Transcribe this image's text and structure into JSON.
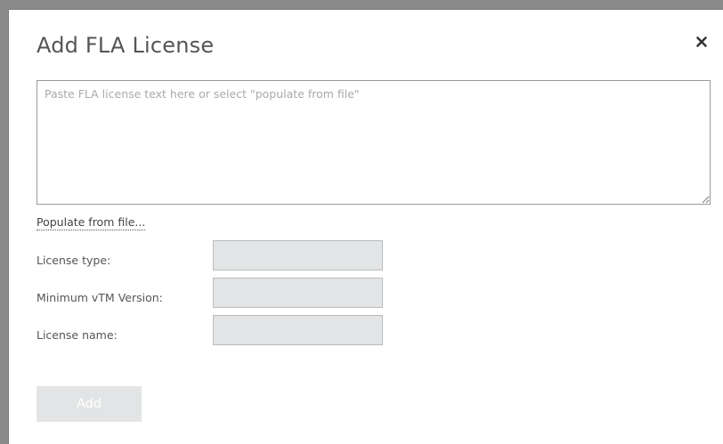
{
  "dialog": {
    "title": "Add FLA License",
    "close_icon": "close-icon"
  },
  "license_text": {
    "value": "",
    "placeholder": "Paste FLA license text here or select \"populate from file\""
  },
  "populate_link": "Populate from file...",
  "fields": [
    {
      "label": "License type:",
      "value": ""
    },
    {
      "label": "Minimum vTM Version:",
      "value": ""
    },
    {
      "label": "License name:",
      "value": ""
    }
  ],
  "add_button": "Add",
  "colors": {
    "backdrop": "#8a8a8a",
    "field_background": "#e2e4e5",
    "button_disabled": "#e2e4e5",
    "title": "#555555"
  }
}
